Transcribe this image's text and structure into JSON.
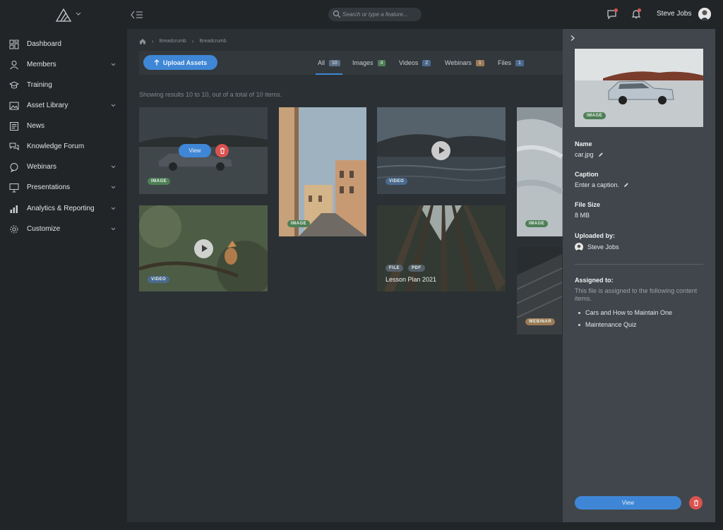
{
  "topbar": {
    "search_placeholder": "Search or type a feature...",
    "user_name": "Steve Jobs"
  },
  "sidebar": {
    "items": [
      {
        "label": "Dashboard",
        "icon": "dashboard-icon",
        "has_children": false
      },
      {
        "label": "Members",
        "icon": "user-icon",
        "has_children": true
      },
      {
        "label": "Training",
        "icon": "graduation-cap-icon",
        "has_children": false
      },
      {
        "label": "Asset Library",
        "icon": "image-gallery-icon",
        "has_children": true
      },
      {
        "label": "News",
        "icon": "newspaper-icon",
        "has_children": false
      },
      {
        "label": "Knowledge Forum",
        "icon": "chat-bubbles-icon",
        "has_children": false
      },
      {
        "label": "Webinars",
        "icon": "speech-bubble-icon",
        "has_children": true
      },
      {
        "label": "Presentations",
        "icon": "presentation-icon",
        "has_children": true
      },
      {
        "label": "Analytics & Reporting",
        "icon": "bar-chart-icon",
        "has_children": true
      },
      {
        "label": "Customize",
        "icon": "gear-icon",
        "has_children": true
      }
    ]
  },
  "breadcrumb": [
    "Breadcrumb",
    "Breadcrumb"
  ],
  "toolbar": {
    "upload_label": "Upload Assets",
    "tabs": [
      {
        "label": "All",
        "count": "10",
        "color": "#5b6f84"
      },
      {
        "label": "Images",
        "count": "4",
        "color": "#4f7f56"
      },
      {
        "label": "Videos",
        "count": "2",
        "color": "#4b6a8f"
      },
      {
        "label": "Webinars",
        "count": "1",
        "color": "#9b7a55"
      },
      {
        "label": "Files",
        "count": "1",
        "color": "#4b6a8f"
      }
    ]
  },
  "results_text": "Showing results 10 to 10, out of a total of 10 items.",
  "cards": {
    "car": {
      "badge": "IMAGE",
      "view_label": "View"
    },
    "street": {
      "badge": "IMAGE"
    },
    "lake": {
      "badge": "VIDEO"
    },
    "snow": {
      "badge": "IMAGE"
    },
    "bird": {
      "badge": "VIDEO"
    },
    "forest": {
      "badges": [
        "FILE",
        "PDF"
      ],
      "title": "Lesson Plan 2021"
    },
    "webinar": {
      "badge": "WEBINAR"
    }
  },
  "panel": {
    "preview_badge": "IMAGE",
    "name_label": "Name",
    "name_value": "car.jpg",
    "caption_label": "Caption",
    "caption_value": "Enter a caption.",
    "size_label": "File Size",
    "size_value": "8 MB",
    "uploaded_label": "Uploaded by:",
    "uploaded_value": "Steve Jobs",
    "assigned_label": "Assigned to:",
    "assigned_note": "This file is assigned to the following content items.",
    "assigned_items": [
      "Cars and How to Maintain One",
      "Maintenance Quiz"
    ],
    "view_label": "View"
  },
  "colors": {
    "accent": "#3f87d6",
    "danger": "#d9534f",
    "notification_dot": "#e05656"
  }
}
